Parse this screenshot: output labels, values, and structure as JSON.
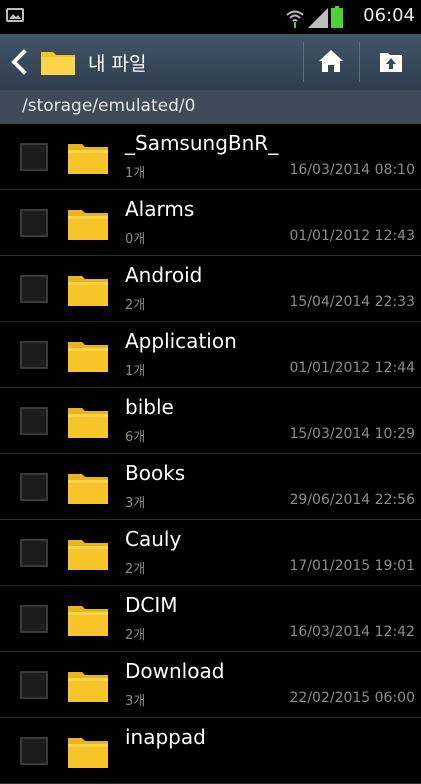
{
  "status_bar": {
    "time": "06:04",
    "left_icon": "image-notification-icon",
    "wifi_icon": "wifi-icon",
    "signal_icon": "signal-icon",
    "battery_icon": "battery-icon"
  },
  "action_bar": {
    "back_icon": "back-arrow-icon",
    "folder_icon": "folder-icon",
    "title": "내 파일",
    "home_icon": "home-icon",
    "up_icon": "folder-up-icon"
  },
  "path": "/storage/emulated/0",
  "colors": {
    "folder": "#f7c52a",
    "action_bar": "#3a4a5c",
    "path_bar": "#3f4b59",
    "battery": "#4cd137"
  },
  "files": [
    {
      "name": "_SamsungBnR_",
      "count": "1개",
      "date": "16/03/2014 08:10"
    },
    {
      "name": "Alarms",
      "count": "0개",
      "date": "01/01/2012 12:43"
    },
    {
      "name": "Android",
      "count": "2개",
      "date": "15/04/2014 22:33"
    },
    {
      "name": "Application",
      "count": "1개",
      "date": "01/01/2012 12:44"
    },
    {
      "name": "bible",
      "count": "6개",
      "date": "15/03/2014 10:29"
    },
    {
      "name": "Books",
      "count": "3개",
      "date": "29/06/2014 22:56"
    },
    {
      "name": "Cauly",
      "count": "2개",
      "date": "17/01/2015 19:01"
    },
    {
      "name": "DCIM",
      "count": "2개",
      "date": "16/03/2014 12:42"
    },
    {
      "name": "Download",
      "count": "3개",
      "date": "22/02/2015 06:00"
    },
    {
      "name": "inappad",
      "count": "",
      "date": ""
    }
  ]
}
